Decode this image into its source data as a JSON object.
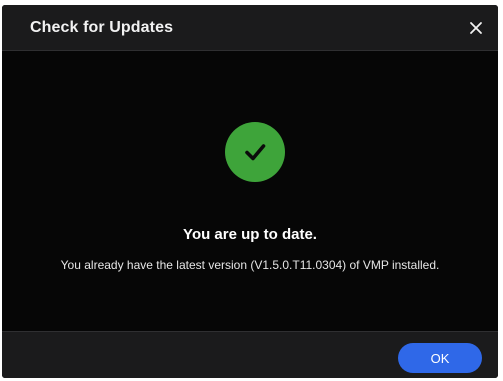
{
  "dialog": {
    "title": "Check for Updates",
    "close_icon": "close-icon",
    "status_icon": "checkmark-circle-icon",
    "status_title": "You are up to date.",
    "status_message": "You already have the latest version (V1.5.0.T11.0304) of VMP installed.",
    "ok_label": "OK"
  },
  "colors": {
    "dialog_background": "#060606",
    "header_background": "#1b1b1c",
    "success_green": "#3ea43a",
    "primary_button": "#2f68e8",
    "text_primary": "#ffffff"
  }
}
